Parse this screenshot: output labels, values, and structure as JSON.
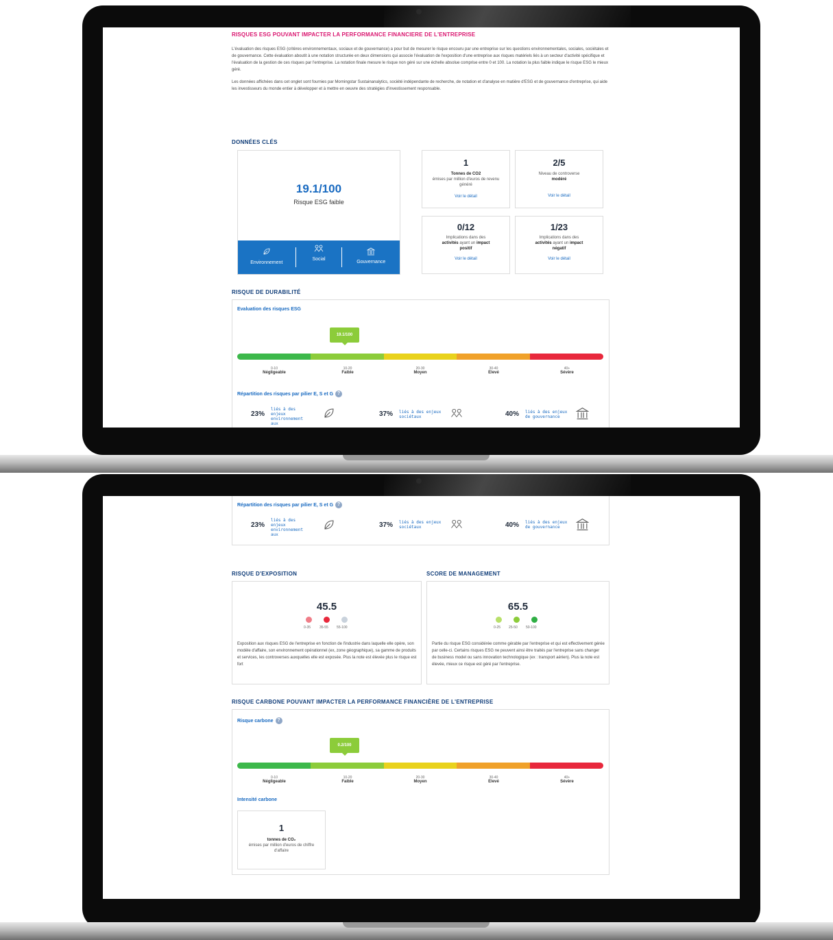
{
  "colors": {
    "pink": "#d9146e",
    "blue": "#0f3c78",
    "link": "#1769c0",
    "accent_box": "#1a73c4",
    "tag": "#8ccc3a",
    "scale": [
      "#3cb84a",
      "#8ccc3a",
      "#e9d21c",
      "#f0a12a",
      "#e8283c"
    ]
  },
  "top": {
    "title": "RISQUES ESG POUVANT IMPACTER LA PERFORMANCE FINANCIERE DE L'ENTREPRISE",
    "para1": "L'évaluation des risques ESG (critères environnementaux, sociaux et de gouvernance) a pour but de mesurer le risque encouru par une entreprise sur les questions environnementales, sociales, sociétales et de gouvernance. Cette évaluation aboutit à une notation structurée en deux dimensions qui associe l'évaluation de l'exposition d'une entreprise aux risques matériels liés à un secteur d'activité spécifique et l'évaluation de la gestion de ces risques par l'entreprise. La notation finale mesure le risque non géré sur une échelle absolue comprise entre 0 et 100. La notation la plus faible indique le risque ESG le mieux géré.",
    "para2": "Les données affichées dans cet onglet sont fournies par Morningstar Sustainanalytics, société indépendante de recherche, de notation et d'analyse en matière d'ESG et de gouvernance d'entreprise, qui aide les investisseurs du monde entier à développer et à mettre en oeuvre des stratégies d'investissement responsable.",
    "key_title": "DONNÉES CLÉS",
    "score": "19.1/100",
    "score_label": "Risque ESG faible",
    "pillars": [
      "Environnement",
      "Social",
      "Gouvernance"
    ],
    "card1": {
      "value": "1",
      "bold": "Tonnes de CO2",
      "text": "émises par million d'euros de revenu généré",
      "link": "Voir le détail"
    },
    "card2": {
      "value": "2/5",
      "text": "Niveau de controverse",
      "bold": "modéré",
      "link": "Voir le détail"
    },
    "card3": {
      "value": "0/12",
      "text1": "Implications dans des",
      "bold1": "activités",
      "text2": "ayant un",
      "bold2": "impact",
      "bold3": "positif",
      "link": "Voir le détail"
    },
    "card4": {
      "value": "1/23",
      "text1": "Implications dans des",
      "bold1": "activités",
      "text2": "ayant un",
      "bold2": "impact",
      "bold3": "négatif",
      "link": "Voir le détail"
    },
    "durability_title": "RISQUE DE DURABILITÉ",
    "eval_title": "Evaluation des risques ESG",
    "eval_tag": "19.1/100"
  },
  "scale": {
    "ranges": [
      "0-10",
      "10-20",
      "20-30",
      "30-40",
      "40+"
    ],
    "names": [
      "Négligeable",
      "Faible",
      "Moyen",
      "Elevé",
      "Sévère"
    ]
  },
  "pillar_split": {
    "title": "Répartition des risques par pilier E, S et G",
    "qmark": "?",
    "items": [
      {
        "pct": "23%",
        "label": "liés à des enjeux environnement aux"
      },
      {
        "pct": "37%",
        "label": "liés à des enjeux sociétaux"
      },
      {
        "pct": "40%",
        "label": "liés à des enjeux de gouvernance"
      }
    ]
  },
  "bottom": {
    "exposure_title": "RISQUE D'EXPOSITION",
    "exposure_value": "45.5",
    "exposure_dots": [
      "0-35",
      "35-55",
      "55-100"
    ],
    "exposure_text": "Exposition aux risques ESG de l'entreprise en fonction de l'industrie dans laquelle elle opère, son modèle d'affaire, son environnement opérationnel (ex, zone géographique), sa gamme de produits et services, les controverses auxquelles elle est exposée. Plus la note est élevée plus le risque est fort",
    "mgmt_title": "SCORE DE MANAGEMENT",
    "mgmt_value": "65.5",
    "mgmt_dots": [
      "0-25",
      "25-50",
      "50-100"
    ],
    "mgmt_text": "Partie du risque ESG considérée comme gérable par l'entreprise et qui est effectivement gérée par celle-ci. Certains risques ESG ne peuvent ainsi être traités par l'entreprise sans changer de business model ou sans innovation technologique (ex : transport aérien). Plus la note est élevée, mieux ce risque est géré par l'entreprise.",
    "carbon_title": "RISQUE CARBONE POUVANT IMPACTER LA PERFORMANCE FINANCIÈRE DE L'ENTREPRISE",
    "carbon_sub": "Risque carbone",
    "carbon_tag": "0.2/100",
    "intensity_title": "Intensité carbone",
    "intensity_value": "1",
    "intensity_bold": "tonnes de CO₂",
    "intensity_text": "émises par million d'euros de chiffre d'affaire"
  }
}
